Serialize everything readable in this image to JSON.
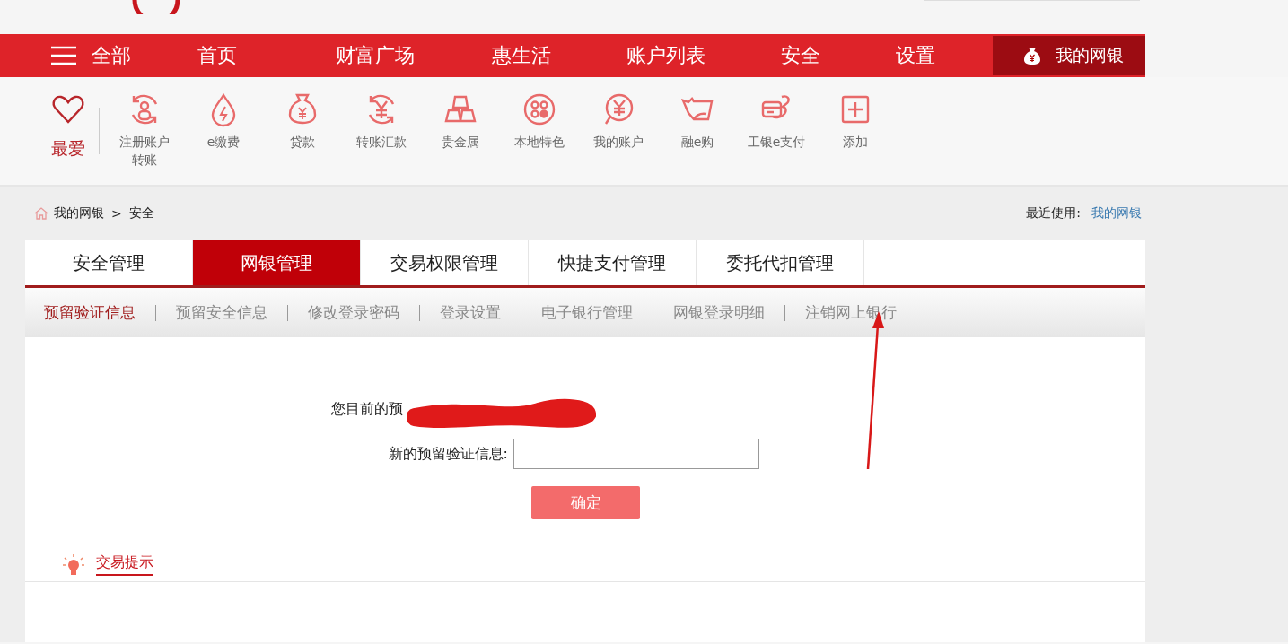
{
  "nav": {
    "menu_label": "全部",
    "items": [
      {
        "label": "首页",
        "selected": false
      },
      {
        "label": "财富广场",
        "selected": false
      },
      {
        "label": "惠生活",
        "selected": false
      },
      {
        "label": "账户列表",
        "selected": false
      },
      {
        "label": "安全",
        "selected": false
      },
      {
        "label": "设置",
        "selected": false
      }
    ],
    "account_tab": {
      "label": "我的网银"
    }
  },
  "shortcuts": [
    {
      "label": "最爱",
      "kind": "heart"
    },
    {
      "label": "注册账户转账",
      "kind": "register"
    },
    {
      "label": "e缴费",
      "kind": "pay"
    },
    {
      "label": "贷款",
      "kind": "loan"
    },
    {
      "label": "转账汇款",
      "kind": "transfer"
    },
    {
      "label": "贵金属",
      "kind": "gold"
    },
    {
      "label": "本地特色",
      "kind": "local"
    },
    {
      "label": "我的账户",
      "kind": "account"
    },
    {
      "label": "融e购",
      "kind": "shop"
    },
    {
      "label": "工银e支付",
      "kind": "epay"
    },
    {
      "label": "添加",
      "kind": "add"
    }
  ],
  "breadcrumb": {
    "items": [
      "我的网银",
      "安全"
    ],
    "separator": ">"
  },
  "recent": {
    "label": "最近使用:",
    "link": "我的网银"
  },
  "tabs": [
    {
      "label": "安全管理",
      "selected": false
    },
    {
      "label": "网银管理",
      "selected": true
    },
    {
      "label": "交易权限管理",
      "selected": false
    },
    {
      "label": "快捷支付管理",
      "selected": false
    },
    {
      "label": "委托代扣管理",
      "selected": false
    }
  ],
  "subtabs": [
    {
      "label": "预留验证信息",
      "selected": true
    },
    {
      "label": "预留安全信息",
      "selected": false
    },
    {
      "label": "修改登录密码",
      "selected": false
    },
    {
      "label": "登录设置",
      "selected": false
    },
    {
      "label": "电子银行管理",
      "selected": false
    },
    {
      "label": "网银登录明细",
      "selected": false
    },
    {
      "label": "注销网上银行",
      "selected": false
    }
  ],
  "form": {
    "current_label": "您目前的预",
    "new_label": "新的预留验证信息:",
    "submit": "确定"
  },
  "tip": {
    "label": "交易提示"
  }
}
